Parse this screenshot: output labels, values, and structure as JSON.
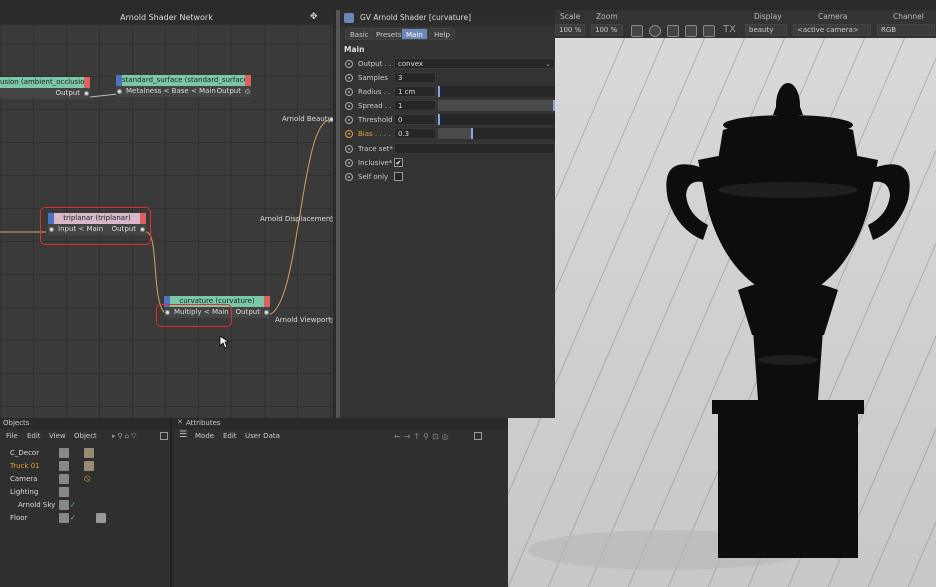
{
  "node_editor": {
    "title": "Arnold Shader Network",
    "nodes": {
      "ao": {
        "title": "usion (ambient_occlusion)",
        "out": "Output"
      },
      "standard": {
        "title": "standard_surface (standard_surface)",
        "in": "Metalness < Base < Main",
        "out": "Output"
      },
      "triplanar": {
        "title": "triplanar (triplanar)",
        "in": "Input < Main",
        "out": "Output"
      },
      "curvature": {
        "title": "curvature (curvature)",
        "in": "Multiply < Main",
        "out": "Output"
      }
    },
    "outputs": {
      "beauty": "Arnold Beauty",
      "displacement": "Arnold Displacement",
      "viewport": "Arnold Viewport"
    }
  },
  "shader_panel": {
    "title": "GV Arnold Shader [curvature]",
    "tabs": [
      "Basic",
      "Presets",
      "Main",
      "Help"
    ],
    "active_tab": "Main",
    "section": "Main",
    "params": {
      "output": {
        "label": "Output . .",
        "value": "convex"
      },
      "samples": {
        "label": "Samples",
        "value": "3"
      },
      "radius": {
        "label": "Radius . .",
        "value": "1 cm",
        "fill": 0.0
      },
      "spread": {
        "label": "Spread . .",
        "value": "1",
        "fill": 1.0
      },
      "threshold": {
        "label": "Threshold",
        "value": "0",
        "fill": 0.0
      },
      "bias": {
        "label": "Bias . . . .",
        "value": "0.3",
        "fill": 0.3
      },
      "trace_set": {
        "label": "Trace set*"
      },
      "inclusive": {
        "label": "Inclusive*",
        "checked": "✔"
      },
      "self_only": {
        "label": "Self only",
        "checked": ""
      }
    }
  },
  "toolbar": {
    "scale_label": "Scale",
    "scale_value": "100 %",
    "zoom_label": "Zoom",
    "zoom_value": "100 %",
    "tx_label": "TX",
    "display_label": "Display",
    "display_value": "beauty",
    "camera_label": "Camera",
    "camera_value": "<active camera>",
    "channel_label": "Channel",
    "channel_value": "RGB"
  },
  "objects_panel": {
    "title": "Objects",
    "menu": [
      "File",
      "Edit",
      "View",
      "Object"
    ],
    "items": [
      {
        "name": "C_Decor"
      },
      {
        "name": "Truck 01"
      },
      {
        "name": "Camera"
      },
      {
        "name": "Lighting"
      },
      {
        "name": "Arnold Sky"
      },
      {
        "name": "Floor"
      }
    ]
  },
  "attributes_panel": {
    "title": "Attributes",
    "menu": [
      "Mode",
      "Edit",
      "User Data"
    ]
  },
  "colors": {
    "accent": "#6b86b8",
    "highlight_box": "#e03030",
    "bias_label": "#e0a040",
    "wire": "#d9a05a"
  }
}
